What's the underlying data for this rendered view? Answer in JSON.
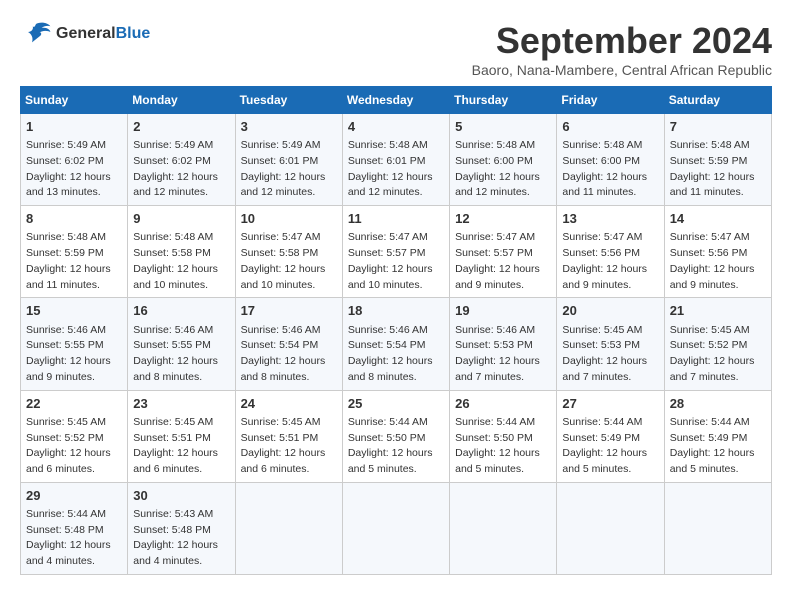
{
  "header": {
    "logo_line1": "General",
    "logo_line2": "Blue",
    "month": "September 2024",
    "location": "Baoro, Nana-Mambere, Central African Republic"
  },
  "days_of_week": [
    "Sunday",
    "Monday",
    "Tuesday",
    "Wednesday",
    "Thursday",
    "Friday",
    "Saturday"
  ],
  "weeks": [
    [
      {
        "day": 1,
        "info": "Sunrise: 5:49 AM\nSunset: 6:02 PM\nDaylight: 12 hours and 13 minutes."
      },
      {
        "day": 2,
        "info": "Sunrise: 5:49 AM\nSunset: 6:02 PM\nDaylight: 12 hours and 12 minutes."
      },
      {
        "day": 3,
        "info": "Sunrise: 5:49 AM\nSunset: 6:01 PM\nDaylight: 12 hours and 12 minutes."
      },
      {
        "day": 4,
        "info": "Sunrise: 5:48 AM\nSunset: 6:01 PM\nDaylight: 12 hours and 12 minutes."
      },
      {
        "day": 5,
        "info": "Sunrise: 5:48 AM\nSunset: 6:00 PM\nDaylight: 12 hours and 12 minutes."
      },
      {
        "day": 6,
        "info": "Sunrise: 5:48 AM\nSunset: 6:00 PM\nDaylight: 12 hours and 11 minutes."
      },
      {
        "day": 7,
        "info": "Sunrise: 5:48 AM\nSunset: 5:59 PM\nDaylight: 12 hours and 11 minutes."
      }
    ],
    [
      {
        "day": 8,
        "info": "Sunrise: 5:48 AM\nSunset: 5:59 PM\nDaylight: 12 hours and 11 minutes."
      },
      {
        "day": 9,
        "info": "Sunrise: 5:48 AM\nSunset: 5:58 PM\nDaylight: 12 hours and 10 minutes."
      },
      {
        "day": 10,
        "info": "Sunrise: 5:47 AM\nSunset: 5:58 PM\nDaylight: 12 hours and 10 minutes."
      },
      {
        "day": 11,
        "info": "Sunrise: 5:47 AM\nSunset: 5:57 PM\nDaylight: 12 hours and 10 minutes."
      },
      {
        "day": 12,
        "info": "Sunrise: 5:47 AM\nSunset: 5:57 PM\nDaylight: 12 hours and 9 minutes."
      },
      {
        "day": 13,
        "info": "Sunrise: 5:47 AM\nSunset: 5:56 PM\nDaylight: 12 hours and 9 minutes."
      },
      {
        "day": 14,
        "info": "Sunrise: 5:47 AM\nSunset: 5:56 PM\nDaylight: 12 hours and 9 minutes."
      }
    ],
    [
      {
        "day": 15,
        "info": "Sunrise: 5:46 AM\nSunset: 5:55 PM\nDaylight: 12 hours and 9 minutes."
      },
      {
        "day": 16,
        "info": "Sunrise: 5:46 AM\nSunset: 5:55 PM\nDaylight: 12 hours and 8 minutes."
      },
      {
        "day": 17,
        "info": "Sunrise: 5:46 AM\nSunset: 5:54 PM\nDaylight: 12 hours and 8 minutes."
      },
      {
        "day": 18,
        "info": "Sunrise: 5:46 AM\nSunset: 5:54 PM\nDaylight: 12 hours and 8 minutes."
      },
      {
        "day": 19,
        "info": "Sunrise: 5:46 AM\nSunset: 5:53 PM\nDaylight: 12 hours and 7 minutes."
      },
      {
        "day": 20,
        "info": "Sunrise: 5:45 AM\nSunset: 5:53 PM\nDaylight: 12 hours and 7 minutes."
      },
      {
        "day": 21,
        "info": "Sunrise: 5:45 AM\nSunset: 5:52 PM\nDaylight: 12 hours and 7 minutes."
      }
    ],
    [
      {
        "day": 22,
        "info": "Sunrise: 5:45 AM\nSunset: 5:52 PM\nDaylight: 12 hours and 6 minutes."
      },
      {
        "day": 23,
        "info": "Sunrise: 5:45 AM\nSunset: 5:51 PM\nDaylight: 12 hours and 6 minutes."
      },
      {
        "day": 24,
        "info": "Sunrise: 5:45 AM\nSunset: 5:51 PM\nDaylight: 12 hours and 6 minutes."
      },
      {
        "day": 25,
        "info": "Sunrise: 5:44 AM\nSunset: 5:50 PM\nDaylight: 12 hours and 5 minutes."
      },
      {
        "day": 26,
        "info": "Sunrise: 5:44 AM\nSunset: 5:50 PM\nDaylight: 12 hours and 5 minutes."
      },
      {
        "day": 27,
        "info": "Sunrise: 5:44 AM\nSunset: 5:49 PM\nDaylight: 12 hours and 5 minutes."
      },
      {
        "day": 28,
        "info": "Sunrise: 5:44 AM\nSunset: 5:49 PM\nDaylight: 12 hours and 5 minutes."
      }
    ],
    [
      {
        "day": 29,
        "info": "Sunrise: 5:44 AM\nSunset: 5:48 PM\nDaylight: 12 hours and 4 minutes."
      },
      {
        "day": 30,
        "info": "Sunrise: 5:43 AM\nSunset: 5:48 PM\nDaylight: 12 hours and 4 minutes."
      },
      null,
      null,
      null,
      null,
      null
    ]
  ]
}
